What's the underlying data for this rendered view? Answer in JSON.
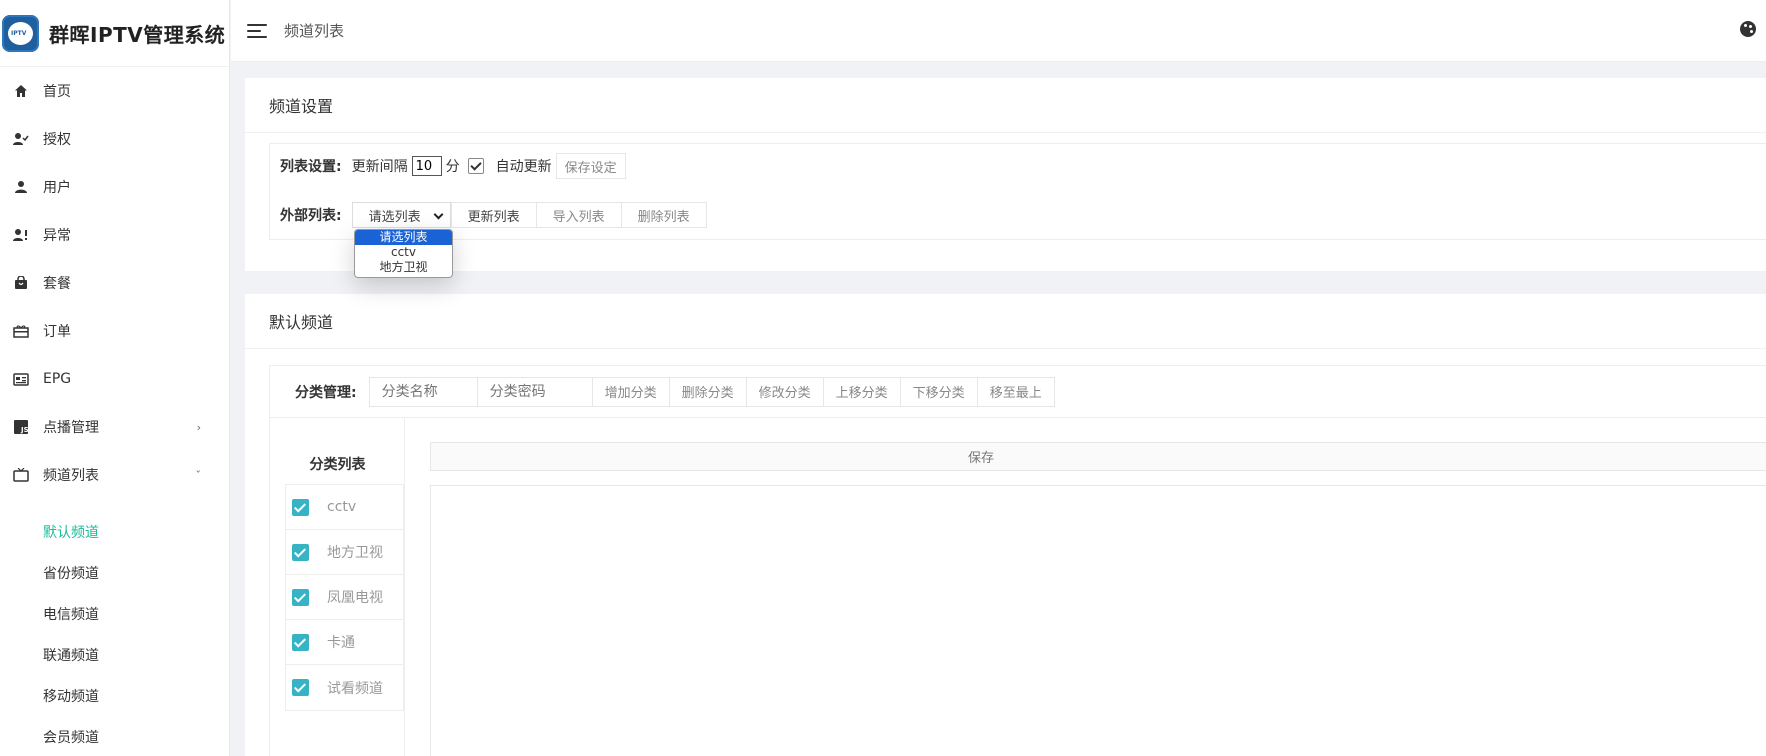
{
  "app": {
    "title": "群晖IPTV管理系统"
  },
  "header": {
    "page_title": "频道列表"
  },
  "sidebar": {
    "items": [
      {
        "label": "首页",
        "icon": "home-icon"
      },
      {
        "label": "授权",
        "icon": "user-check-icon"
      },
      {
        "label": "用户",
        "icon": "user-icon"
      },
      {
        "label": "异常",
        "icon": "user-alert-icon"
      },
      {
        "label": "套餐",
        "icon": "bag-icon"
      },
      {
        "label": "订单",
        "icon": "gift-icon"
      },
      {
        "label": "EPG",
        "icon": "epg-icon"
      },
      {
        "label": "点播管理",
        "icon": "js-icon",
        "arrow": "›"
      },
      {
        "label": "频道列表",
        "icon": "tv-icon",
        "arrow": "ˇ"
      }
    ],
    "submenu": [
      {
        "label": "默认频道",
        "active": true
      },
      {
        "label": "省份频道"
      },
      {
        "label": "电信频道"
      },
      {
        "label": "联通频道"
      },
      {
        "label": "移动频道"
      },
      {
        "label": "会员频道"
      }
    ]
  },
  "settings": {
    "title": "频道设置",
    "list_label": "列表设置:",
    "interval_label": "更新间隔",
    "interval_value": "10",
    "interval_unit": "分",
    "auto_update_label": "自动更新",
    "auto_update_checked": true,
    "save_label": "保存设定",
    "external_label": "外部列表:",
    "select_value": "请选列表",
    "select_options": [
      "请选列表",
      "cctv",
      "地方卫视"
    ],
    "update_list": "更新列表",
    "import_list": "导入列表",
    "delete_list": "删除列表"
  },
  "default_channel": {
    "title": "默认频道",
    "category_label": "分类管理:",
    "name_placeholder": "分类名称",
    "password_placeholder": "分类密码",
    "buttons": [
      "增加分类",
      "删除分类",
      "修改分类",
      "上移分类",
      "下移分类",
      "移至最上"
    ],
    "list_header": "分类列表",
    "categories": [
      {
        "name": "cctv",
        "checked": true
      },
      {
        "name": "地方卫视",
        "checked": true
      },
      {
        "name": "凤凰电视",
        "checked": true
      },
      {
        "name": "卡通",
        "checked": true
      },
      {
        "name": "试看频道",
        "checked": true
      }
    ],
    "save_label": "保存"
  },
  "colors": {
    "accent": "#1abc9c",
    "checkbox": "#36b4c6",
    "select_highlight": "#1a63d6",
    "logo": "#1f5fa0"
  }
}
